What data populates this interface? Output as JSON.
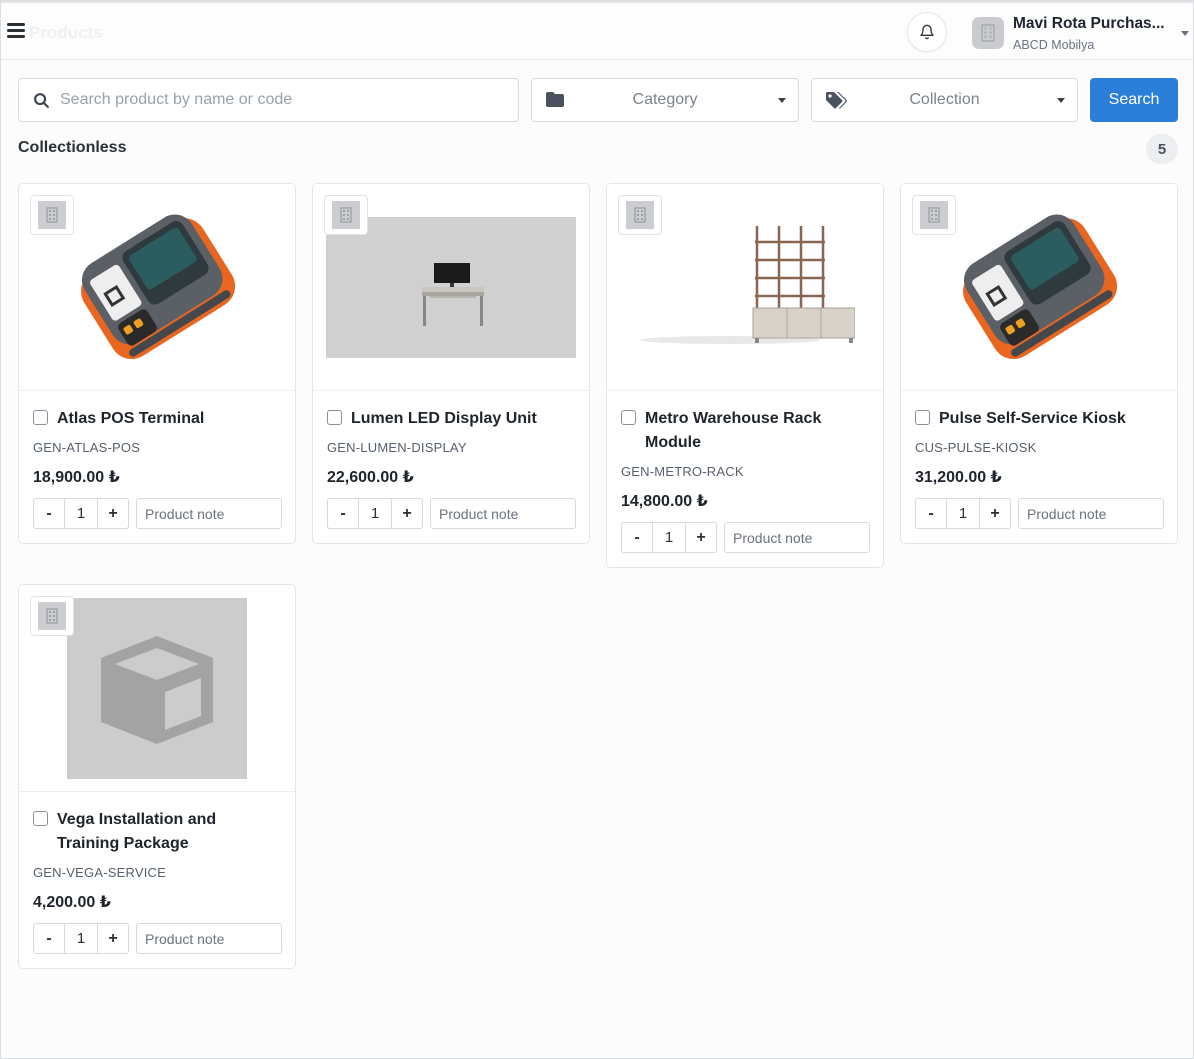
{
  "header": {
    "ghost_title": "Products",
    "user": {
      "name": "Mavi Rota Purchas...",
      "company": "ABCD Mobilya"
    }
  },
  "filters": {
    "search_placeholder": "Search product by name or code",
    "category_label": "Category",
    "collection_label": "Collection",
    "search_button": "Search"
  },
  "section": {
    "title": "Collectionless",
    "count": "5"
  },
  "qty_minus": "-",
  "qty_plus": "+",
  "note_placeholder": "Product note",
  "products": [
    {
      "name": "Atlas POS Terminal",
      "code": "GEN-ATLAS-POS",
      "price": "18,900.00 ₺",
      "qty": "1",
      "image": "printer"
    },
    {
      "name": "Lumen LED Display Unit",
      "code": "GEN-LUMEN-DISPLAY",
      "price": "22,600.00 ₺",
      "qty": "1",
      "image": "display-desk"
    },
    {
      "name": "Metro Warehouse Rack Module",
      "code": "GEN-METRO-RACK",
      "price": "14,800.00 ₺",
      "qty": "1",
      "image": "rack"
    },
    {
      "name": "Pulse Self-Service Kiosk",
      "code": "CUS-PULSE-KIOSK",
      "price": "31,200.00 ₺",
      "qty": "1",
      "image": "printer"
    },
    {
      "name": "Vega Installation and Training Package",
      "code": "GEN-VEGA-SERVICE",
      "price": "4,200.00 ₺",
      "qty": "1",
      "image": "placeholder-box"
    }
  ],
  "colors": {
    "accent": "#2b7fd8",
    "printer_orange": "#e8661f",
    "printer_body": "#555a60"
  }
}
